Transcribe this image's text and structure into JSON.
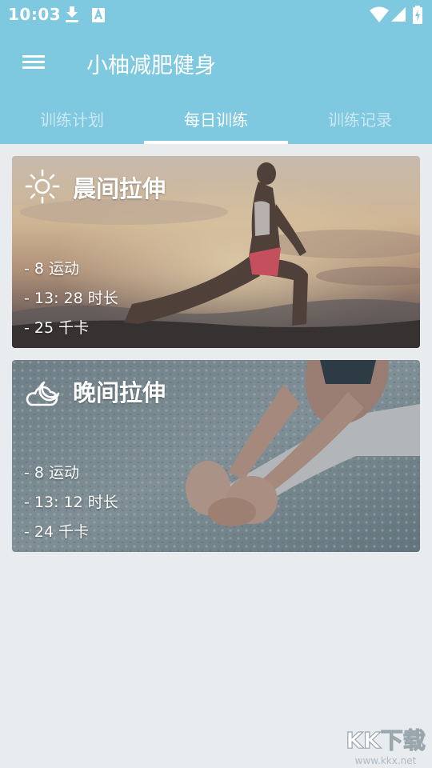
{
  "status_bar": {
    "time": "10:03"
  },
  "app_bar": {
    "title": "小柚减肥健身"
  },
  "tabs": [
    {
      "label": "训练计划"
    },
    {
      "label": "每日训练"
    },
    {
      "label": "训练记录"
    }
  ],
  "workouts": [
    {
      "title": "晨间拉伸",
      "exercises": "- 8 运动",
      "duration": "- 13: 28 时长",
      "calories": "- 25 千卡",
      "icon": "sun-icon"
    },
    {
      "title": "晚间拉伸",
      "exercises": "- 8 运动",
      "duration": "- 13: 12 时长",
      "calories": "- 24 千卡",
      "icon": "cloud-moon-icon"
    }
  ],
  "watermark": {
    "main": "KK下载",
    "sub": "www.kkx.net"
  },
  "colors": {
    "header": "#7ec8e0",
    "background": "#e8ecef"
  }
}
